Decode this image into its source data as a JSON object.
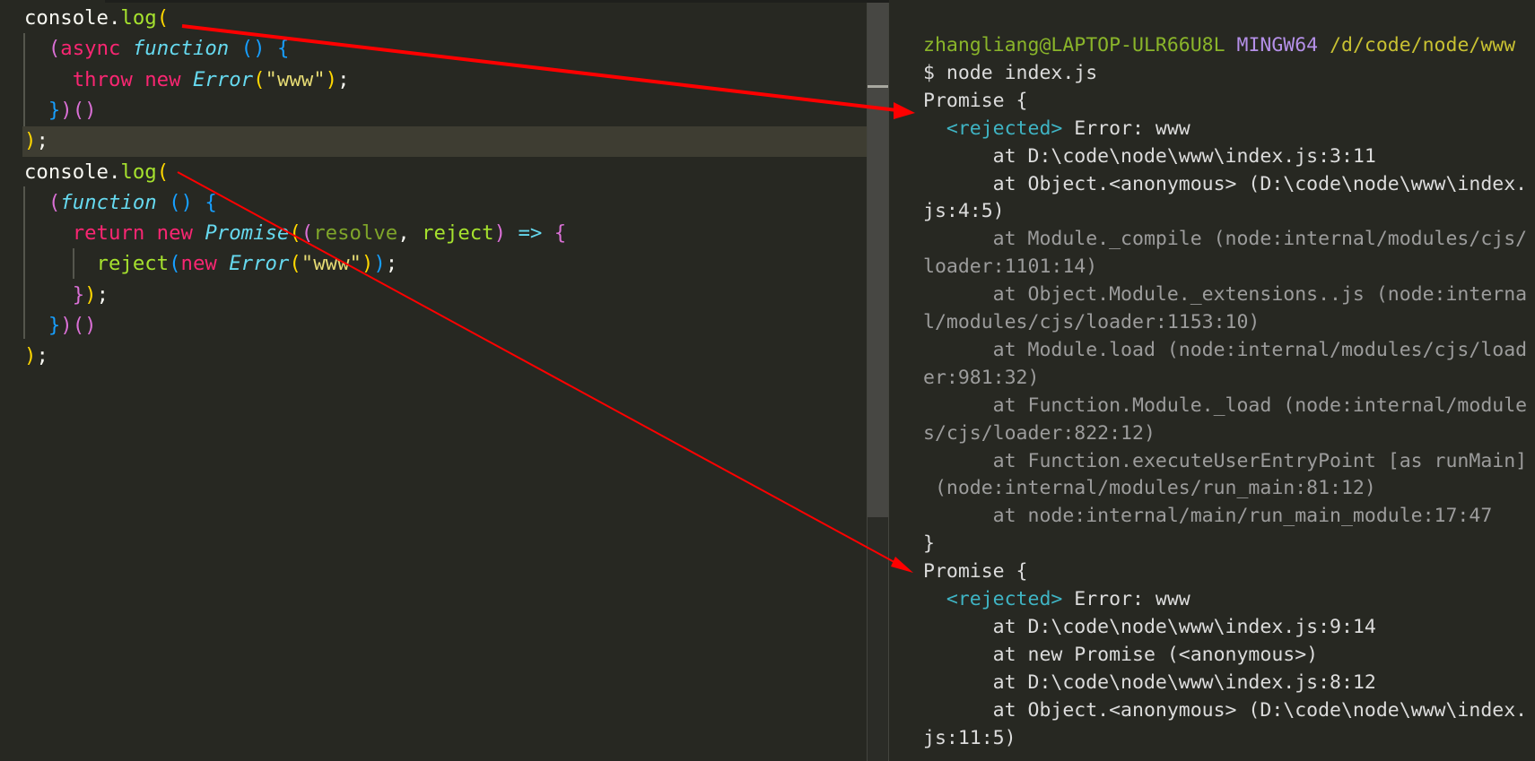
{
  "editor": {
    "current_line": 5,
    "lines": [
      [
        [
          "console.",
          "plain"
        ],
        [
          "log",
          "fn"
        ],
        [
          "(",
          "b1"
        ]
      ],
      [
        [
          "  ",
          "plain"
        ],
        [
          "(",
          "b2"
        ],
        [
          "async ",
          "kw"
        ],
        [
          "function ",
          "it"
        ],
        [
          "()",
          "b3"
        ],
        [
          " ",
          "plain"
        ],
        [
          "{",
          "b3"
        ]
      ],
      [
        [
          "    ",
          "plain"
        ],
        [
          "throw ",
          "kw"
        ],
        [
          "new ",
          "kw"
        ],
        [
          "Error",
          "it"
        ],
        [
          "(",
          "b1"
        ],
        [
          "\"www\"",
          "str"
        ],
        [
          ")",
          "b1"
        ],
        [
          ";",
          "plain"
        ]
      ],
      [
        [
          "  ",
          "plain"
        ],
        [
          "}",
          "b3"
        ],
        [
          ")",
          "b2"
        ],
        [
          "()",
          "b2"
        ]
      ],
      [
        [
          ")",
          "b1"
        ],
        [
          ";",
          "plain"
        ]
      ],
      [
        [
          "console.",
          "plain"
        ],
        [
          "log",
          "fn"
        ],
        [
          "(",
          "b1"
        ]
      ],
      [
        [
          "  ",
          "plain"
        ],
        [
          "(",
          "b2"
        ],
        [
          "function ",
          "it"
        ],
        [
          "()",
          "b3"
        ],
        [
          " ",
          "plain"
        ],
        [
          "{",
          "b3"
        ]
      ],
      [
        [
          "    ",
          "plain"
        ],
        [
          "return ",
          "kw"
        ],
        [
          "new ",
          "kw"
        ],
        [
          "Promise",
          "it"
        ],
        [
          "(",
          "b1"
        ],
        [
          "(",
          "b2"
        ],
        [
          "resolve",
          "param"
        ],
        [
          ", ",
          "plain"
        ],
        [
          "reject",
          "fn"
        ],
        [
          ")",
          "b2"
        ],
        [
          " ",
          "plain"
        ],
        [
          "=>",
          "op"
        ],
        [
          " ",
          "plain"
        ],
        [
          "{",
          "b2"
        ]
      ],
      [
        [
          "      ",
          "plain"
        ],
        [
          "reject",
          "fn"
        ],
        [
          "(",
          "b3"
        ],
        [
          "new ",
          "kw"
        ],
        [
          "Error",
          "it"
        ],
        [
          "(",
          "b1"
        ],
        [
          "\"www\"",
          "str"
        ],
        [
          ")",
          "b1"
        ],
        [
          ")",
          "b3"
        ],
        [
          ";",
          "plain"
        ]
      ],
      [
        [
          "    ",
          "plain"
        ],
        [
          "}",
          "b2"
        ],
        [
          ")",
          "b1"
        ],
        [
          ";",
          "plain"
        ]
      ],
      [
        [
          "  ",
          "plain"
        ],
        [
          "}",
          "b3"
        ],
        [
          ")",
          "b2"
        ],
        [
          "()",
          "b2"
        ]
      ],
      [
        [
          ")",
          "b1"
        ],
        [
          ";",
          "plain"
        ]
      ]
    ]
  },
  "terminal": {
    "lines": [
      [
        [
          "zhangliang@LAPTOP-ULR66U8L ",
          "user"
        ],
        [
          "MINGW64 ",
          "sys"
        ],
        [
          "/d/code/node/www",
          "path"
        ]
      ],
      [
        [
          "$ node index.js",
          "text"
        ]
      ],
      [
        [
          "Promise {",
          "text"
        ]
      ],
      [
        [
          "  ",
          "text"
        ],
        [
          "<rejected>",
          "tag"
        ],
        [
          " Error: www",
          "text"
        ]
      ],
      [
        [
          "      at D:\\code\\node\\www\\index.js:3:11",
          "text"
        ]
      ],
      [
        [
          "      at Object.<anonymous> (D:\\code\\node\\www\\index.",
          "text"
        ]
      ],
      [
        [
          "js:4:5)",
          "text"
        ]
      ],
      [
        [
          "      at Module._compile (node:internal/modules/cjs/",
          "dim"
        ]
      ],
      [
        [
          "loader:1101:14)",
          "dim"
        ]
      ],
      [
        [
          "      at Object.Module._extensions..js (node:interna",
          "dim"
        ]
      ],
      [
        [
          "l/modules/cjs/loader:1153:10)",
          "dim"
        ]
      ],
      [
        [
          "      at Module.load (node:internal/modules/cjs/load",
          "dim"
        ]
      ],
      [
        [
          "er:981:32)",
          "dim"
        ]
      ],
      [
        [
          "      at Function.Module._load (node:internal/module",
          "dim"
        ]
      ],
      [
        [
          "s/cjs/loader:822:12)",
          "dim"
        ]
      ],
      [
        [
          "      at Function.executeUserEntryPoint [as runMain]",
          "dim"
        ]
      ],
      [
        [
          " (node:internal/modules/run_main:81:12)",
          "dim"
        ]
      ],
      [
        [
          "      at node:internal/main/run_main_module:17:47",
          "dim"
        ]
      ],
      [
        [
          "}",
          "text"
        ]
      ],
      [
        [
          "Promise {",
          "text"
        ]
      ],
      [
        [
          "  ",
          "text"
        ],
        [
          "<rejected>",
          "tag"
        ],
        [
          " Error: www",
          "text"
        ]
      ],
      [
        [
          "      at D:\\code\\node\\www\\index.js:9:14",
          "text"
        ]
      ],
      [
        [
          "      at new Promise (<anonymous>)",
          "text"
        ]
      ],
      [
        [
          "      at D:\\code\\node\\www\\index.js:8:12",
          "text"
        ]
      ],
      [
        [
          "      at Object.<anonymous> (D:\\code\\node\\www\\index.",
          "text"
        ]
      ],
      [
        [
          "js:11:5)",
          "text"
        ]
      ]
    ]
  },
  "annotations": {
    "color": "#ff0000",
    "arrows": [
      {
        "from": "editor line 1 console.log(",
        "to": "terminal first Promise {"
      },
      {
        "from": "editor line 6 console.log(",
        "to": "terminal second Promise {"
      }
    ]
  }
}
